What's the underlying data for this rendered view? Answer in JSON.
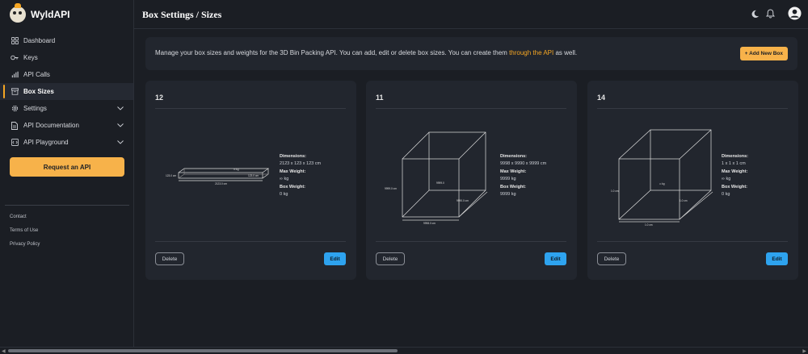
{
  "app": {
    "name": "WyldAPI"
  },
  "header": {
    "title": "Box Settings / Sizes"
  },
  "sidebar": {
    "items": [
      {
        "label": "Dashboard",
        "icon": "dashboard-icon"
      },
      {
        "label": "Keys",
        "icon": "keys-icon"
      },
      {
        "label": "API Calls",
        "icon": "chart-icon"
      },
      {
        "label": "Box Sizes",
        "icon": "box-icon",
        "active": true
      },
      {
        "label": "Settings",
        "icon": "gear-icon"
      },
      {
        "label": "API Documentation",
        "icon": "document-icon"
      },
      {
        "label": "API Playground",
        "icon": "code-icon"
      }
    ],
    "request_button": "Request an API",
    "footer_links": [
      "Contact",
      "Terms of Use",
      "Privacy Policy"
    ]
  },
  "banner": {
    "text_before": "Manage your box sizes and weights for the 3D Bin Packing API. You can add, edit or delete box sizes. You can create them ",
    "link_text": "through the API",
    "text_after": " as well.",
    "add_button": "+ Add New Box"
  },
  "labels": {
    "dimensions": "Dimensions:",
    "max_weight": "Max Weight:",
    "box_weight": "Box Weight:",
    "delete": "Delete",
    "edit": "Edit"
  },
  "cards": [
    {
      "title": "12",
      "dimensions": "2123 x 123 x 123 cm",
      "max_weight": "∞ kg",
      "box_weight": "0 kg",
      "diagram": {
        "top": "∞ kg",
        "left": "123.0 cm",
        "right": "123.0 cm",
        "bottom": "2123.0 cm"
      }
    },
    {
      "title": "11",
      "dimensions": "9998 x 9990 x 9999 cm",
      "max_weight": "9999 kg",
      "box_weight": "9999 kg",
      "diagram": {
        "center": "9999.0",
        "left": "9999.0 cm",
        "right": "9990.0 cm",
        "bottom": "9998.0 cm"
      }
    },
    {
      "title": "14",
      "dimensions": "1 x 1 x 1 cm",
      "max_weight": "∞ kg",
      "box_weight": "0 kg",
      "diagram": {
        "center": "∞ kg",
        "left": "1.0 cm",
        "right": "1.0 cm",
        "bottom": "1.0 cm"
      }
    }
  ]
}
